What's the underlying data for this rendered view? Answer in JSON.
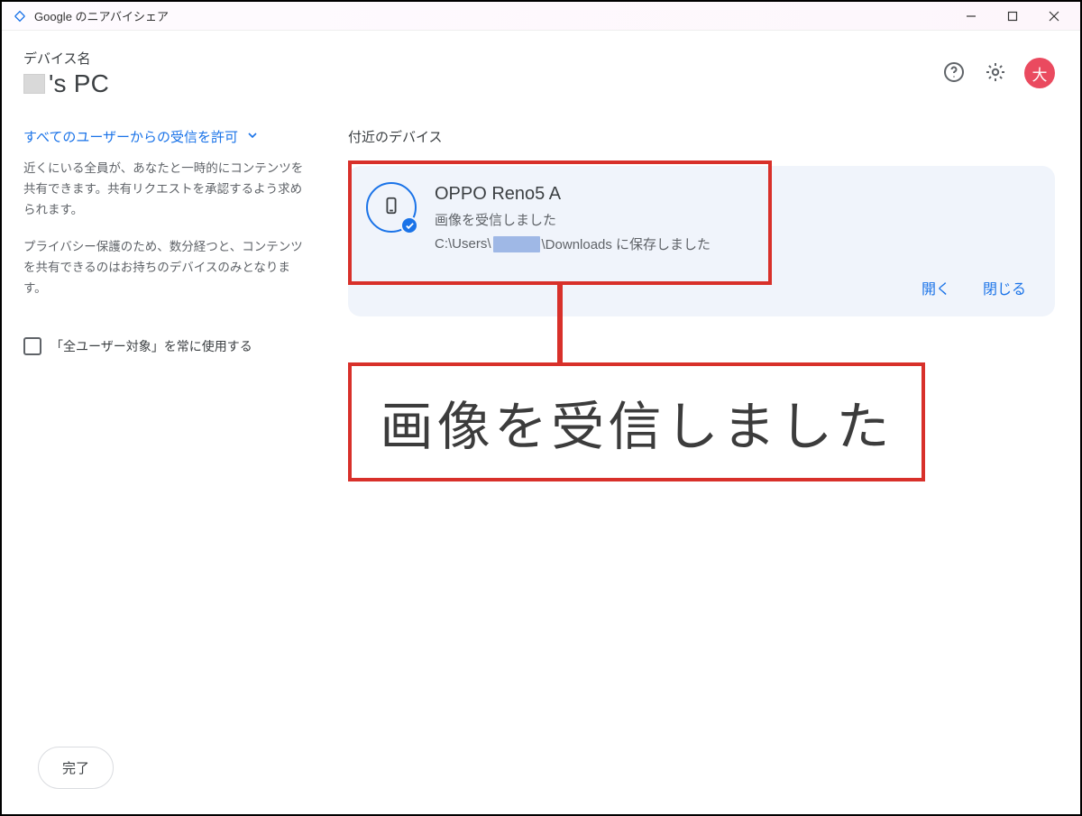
{
  "window": {
    "title": "Google のニアバイシェア"
  },
  "header": {
    "device_label": "デバイス名",
    "device_name_suffix": "'s PC",
    "avatar_initial": "大"
  },
  "sidebar": {
    "visibility_label": "すべてのユーザーからの受信を許可",
    "desc1": "近くにいる全員が、あなたと一時的にコンテンツを共有できます。共有リクエストを承認するよう求められます。",
    "desc2": "プライバシー保護のため、数分経つと、コンテンツを共有できるのはお持ちのデバイスのみとなります。",
    "checkbox_label": "「全ユーザー対象」を常に使用する"
  },
  "main": {
    "nearby_label": "付近のデバイス",
    "device": {
      "name": "OPPO Reno5 A",
      "status": "画像を受信しました",
      "path_prefix": "C:\\Users\\",
      "path_suffix": "\\Downloads に保存しました"
    },
    "actions": {
      "open": "開く",
      "close": "閉じる"
    }
  },
  "annotation": {
    "zoom_text": "画像を受信しました"
  },
  "footer": {
    "done": "完了"
  }
}
